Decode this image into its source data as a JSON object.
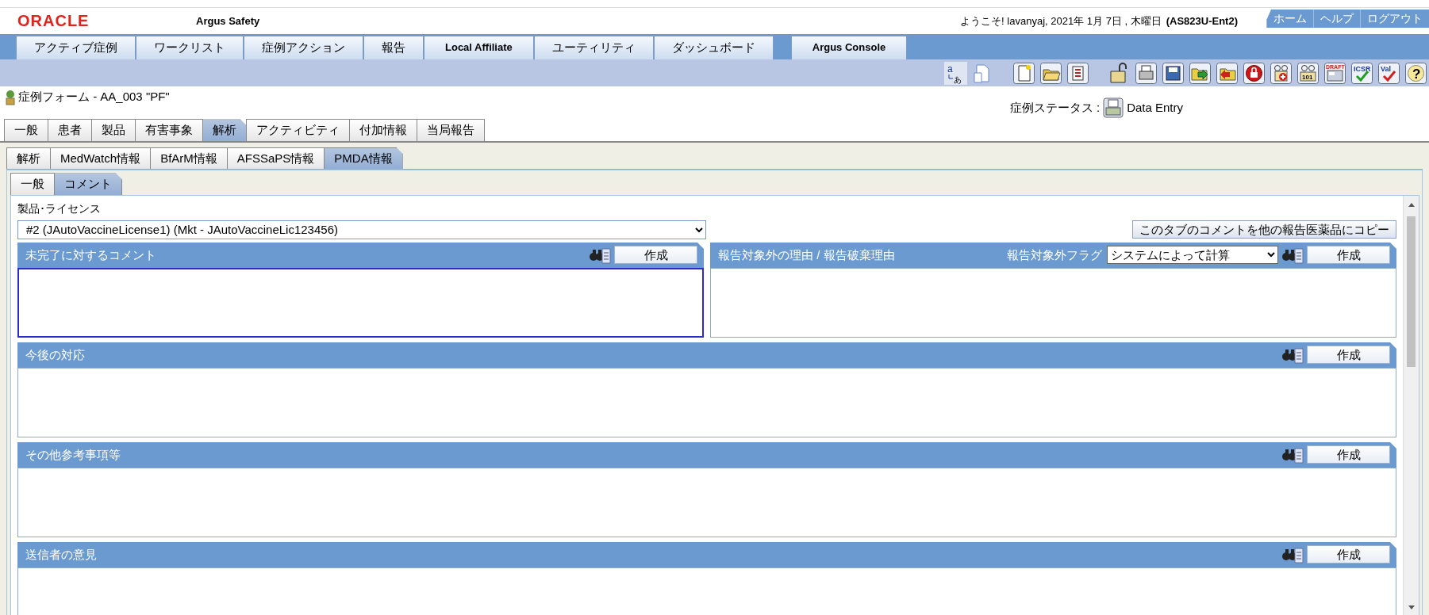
{
  "header": {
    "logo": "ORACLE",
    "app_name": "Argus Safety",
    "welcome": "ようこそ! lavanyaj, 2021年 1月 7日 , 木曜日",
    "server": "(AS823U-Ent2)",
    "links": [
      {
        "label": "ホーム"
      },
      {
        "label": "ヘルプ"
      },
      {
        "label": "ログアウト"
      }
    ]
  },
  "menu": [
    {
      "label": "アクティブ症例",
      "bold": false
    },
    {
      "label": "ワークリスト",
      "bold": false
    },
    {
      "label": "症例アクション",
      "bold": false
    },
    {
      "label": "報告",
      "bold": false
    },
    {
      "label": "Local Affiliate",
      "bold": true
    },
    {
      "label": "ユーティリティ",
      "bold": false
    },
    {
      "label": "ダッシュボード",
      "bold": false
    },
    {
      "label": "Argus Console",
      "bold": true
    }
  ],
  "toolbar_groups": [
    {
      "items": [
        {
          "kind": "translate",
          "label_a": "a",
          "label_b": "あ"
        },
        {
          "kind": "document"
        }
      ]
    },
    {
      "items": [
        {
          "kind": "new"
        },
        {
          "kind": "folder"
        },
        {
          "kind": "list"
        }
      ]
    },
    {
      "items": [
        {
          "kind": "unlock"
        },
        {
          "kind": "print"
        },
        {
          "kind": "save"
        },
        {
          "kind": "forward"
        },
        {
          "kind": "return"
        },
        {
          "kind": "lock"
        },
        {
          "kind": "glasses-plus"
        },
        {
          "kind": "glasses-text",
          "label": "101"
        },
        {
          "kind": "draft",
          "label": "DRAFT"
        },
        {
          "kind": "check",
          "label": "ICSR"
        },
        {
          "kind": "check",
          "label": "Val"
        },
        {
          "kind": "help",
          "label": "?"
        }
      ]
    }
  ],
  "case_form": {
    "title": "症例フォーム - AA_003 \"PF\"",
    "status_label": "症例ステータス :",
    "status": "Data Entry"
  },
  "tabs": [
    {
      "label": "一般",
      "selected": false
    },
    {
      "label": "患者",
      "selected": false
    },
    {
      "label": "製品",
      "selected": false
    },
    {
      "label": "有害事象",
      "selected": false
    },
    {
      "label": "解析",
      "selected": true
    },
    {
      "label": "アクティビティ",
      "selected": false
    },
    {
      "label": "付加情報",
      "selected": false
    },
    {
      "label": "当局報告",
      "selected": false
    }
  ],
  "sub_tabs": [
    {
      "label": "解析",
      "selected": false
    },
    {
      "label": "MedWatch情報",
      "selected": false
    },
    {
      "label": "BfArM情報",
      "selected": false
    },
    {
      "label": "AFSSaPS情報",
      "selected": false
    },
    {
      "label": "PMDA情報",
      "selected": true
    }
  ],
  "inner_tabs": [
    {
      "label": "一般",
      "selected": false
    },
    {
      "label": "コメント",
      "selected": true
    }
  ],
  "product_license": {
    "label": "製品･ライセンス",
    "value": "#2 (JAutoVaccineLicense1) (Mkt - JAutoVaccineLic123456)",
    "copy_button": "このタブのコメントを他の報告医薬品にコピー"
  },
  "sections": [
    {
      "kind": "half",
      "title": "未完了に対するコメント",
      "button": "作成",
      "focused": true
    },
    {
      "kind": "half",
      "title": "報告対象外の理由 / 報告破棄理由",
      "flag_label": "報告対象外フラグ",
      "flag_value": "システムによって計算",
      "button": "作成",
      "focused": false
    },
    {
      "kind": "full",
      "title": "今後の対応",
      "button": "作成",
      "focused": false
    },
    {
      "kind": "full",
      "title": "その他参考事項等",
      "button": "作成",
      "focused": false
    },
    {
      "kind": "full",
      "title": "送信者の意見",
      "button": "作成",
      "focused": false
    }
  ]
}
